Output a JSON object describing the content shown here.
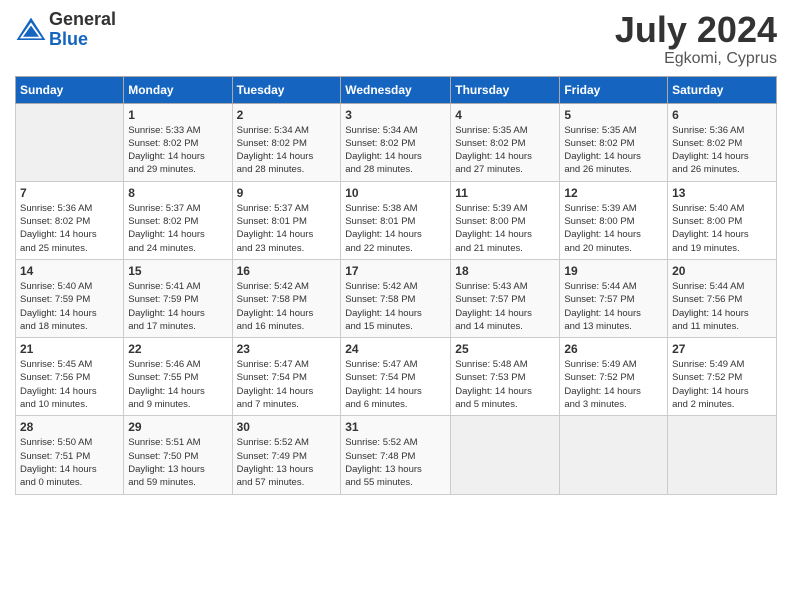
{
  "logo": {
    "general": "General",
    "blue": "Blue"
  },
  "title": {
    "month_year": "July 2024",
    "location": "Egkomi, Cyprus"
  },
  "weekdays": [
    "Sunday",
    "Monday",
    "Tuesday",
    "Wednesday",
    "Thursday",
    "Friday",
    "Saturday"
  ],
  "weeks": [
    [
      {
        "day": "",
        "info": ""
      },
      {
        "day": "1",
        "info": "Sunrise: 5:33 AM\nSunset: 8:02 PM\nDaylight: 14 hours\nand 29 minutes."
      },
      {
        "day": "2",
        "info": "Sunrise: 5:34 AM\nSunset: 8:02 PM\nDaylight: 14 hours\nand 28 minutes."
      },
      {
        "day": "3",
        "info": "Sunrise: 5:34 AM\nSunset: 8:02 PM\nDaylight: 14 hours\nand 28 minutes."
      },
      {
        "day": "4",
        "info": "Sunrise: 5:35 AM\nSunset: 8:02 PM\nDaylight: 14 hours\nand 27 minutes."
      },
      {
        "day": "5",
        "info": "Sunrise: 5:35 AM\nSunset: 8:02 PM\nDaylight: 14 hours\nand 26 minutes."
      },
      {
        "day": "6",
        "info": "Sunrise: 5:36 AM\nSunset: 8:02 PM\nDaylight: 14 hours\nand 26 minutes."
      }
    ],
    [
      {
        "day": "7",
        "info": "Sunrise: 5:36 AM\nSunset: 8:02 PM\nDaylight: 14 hours\nand 25 minutes."
      },
      {
        "day": "8",
        "info": "Sunrise: 5:37 AM\nSunset: 8:02 PM\nDaylight: 14 hours\nand 24 minutes."
      },
      {
        "day": "9",
        "info": "Sunrise: 5:37 AM\nSunset: 8:01 PM\nDaylight: 14 hours\nand 23 minutes."
      },
      {
        "day": "10",
        "info": "Sunrise: 5:38 AM\nSunset: 8:01 PM\nDaylight: 14 hours\nand 22 minutes."
      },
      {
        "day": "11",
        "info": "Sunrise: 5:39 AM\nSunset: 8:00 PM\nDaylight: 14 hours\nand 21 minutes."
      },
      {
        "day": "12",
        "info": "Sunrise: 5:39 AM\nSunset: 8:00 PM\nDaylight: 14 hours\nand 20 minutes."
      },
      {
        "day": "13",
        "info": "Sunrise: 5:40 AM\nSunset: 8:00 PM\nDaylight: 14 hours\nand 19 minutes."
      }
    ],
    [
      {
        "day": "14",
        "info": "Sunrise: 5:40 AM\nSunset: 7:59 PM\nDaylight: 14 hours\nand 18 minutes."
      },
      {
        "day": "15",
        "info": "Sunrise: 5:41 AM\nSunset: 7:59 PM\nDaylight: 14 hours\nand 17 minutes."
      },
      {
        "day": "16",
        "info": "Sunrise: 5:42 AM\nSunset: 7:58 PM\nDaylight: 14 hours\nand 16 minutes."
      },
      {
        "day": "17",
        "info": "Sunrise: 5:42 AM\nSunset: 7:58 PM\nDaylight: 14 hours\nand 15 minutes."
      },
      {
        "day": "18",
        "info": "Sunrise: 5:43 AM\nSunset: 7:57 PM\nDaylight: 14 hours\nand 14 minutes."
      },
      {
        "day": "19",
        "info": "Sunrise: 5:44 AM\nSunset: 7:57 PM\nDaylight: 14 hours\nand 13 minutes."
      },
      {
        "day": "20",
        "info": "Sunrise: 5:44 AM\nSunset: 7:56 PM\nDaylight: 14 hours\nand 11 minutes."
      }
    ],
    [
      {
        "day": "21",
        "info": "Sunrise: 5:45 AM\nSunset: 7:56 PM\nDaylight: 14 hours\nand 10 minutes."
      },
      {
        "day": "22",
        "info": "Sunrise: 5:46 AM\nSunset: 7:55 PM\nDaylight: 14 hours\nand 9 minutes."
      },
      {
        "day": "23",
        "info": "Sunrise: 5:47 AM\nSunset: 7:54 PM\nDaylight: 14 hours\nand 7 minutes."
      },
      {
        "day": "24",
        "info": "Sunrise: 5:47 AM\nSunset: 7:54 PM\nDaylight: 14 hours\nand 6 minutes."
      },
      {
        "day": "25",
        "info": "Sunrise: 5:48 AM\nSunset: 7:53 PM\nDaylight: 14 hours\nand 5 minutes."
      },
      {
        "day": "26",
        "info": "Sunrise: 5:49 AM\nSunset: 7:52 PM\nDaylight: 14 hours\nand 3 minutes."
      },
      {
        "day": "27",
        "info": "Sunrise: 5:49 AM\nSunset: 7:52 PM\nDaylight: 14 hours\nand 2 minutes."
      }
    ],
    [
      {
        "day": "28",
        "info": "Sunrise: 5:50 AM\nSunset: 7:51 PM\nDaylight: 14 hours\nand 0 minutes."
      },
      {
        "day": "29",
        "info": "Sunrise: 5:51 AM\nSunset: 7:50 PM\nDaylight: 13 hours\nand 59 minutes."
      },
      {
        "day": "30",
        "info": "Sunrise: 5:52 AM\nSunset: 7:49 PM\nDaylight: 13 hours\nand 57 minutes."
      },
      {
        "day": "31",
        "info": "Sunrise: 5:52 AM\nSunset: 7:48 PM\nDaylight: 13 hours\nand 55 minutes."
      },
      {
        "day": "",
        "info": ""
      },
      {
        "day": "",
        "info": ""
      },
      {
        "day": "",
        "info": ""
      }
    ]
  ]
}
